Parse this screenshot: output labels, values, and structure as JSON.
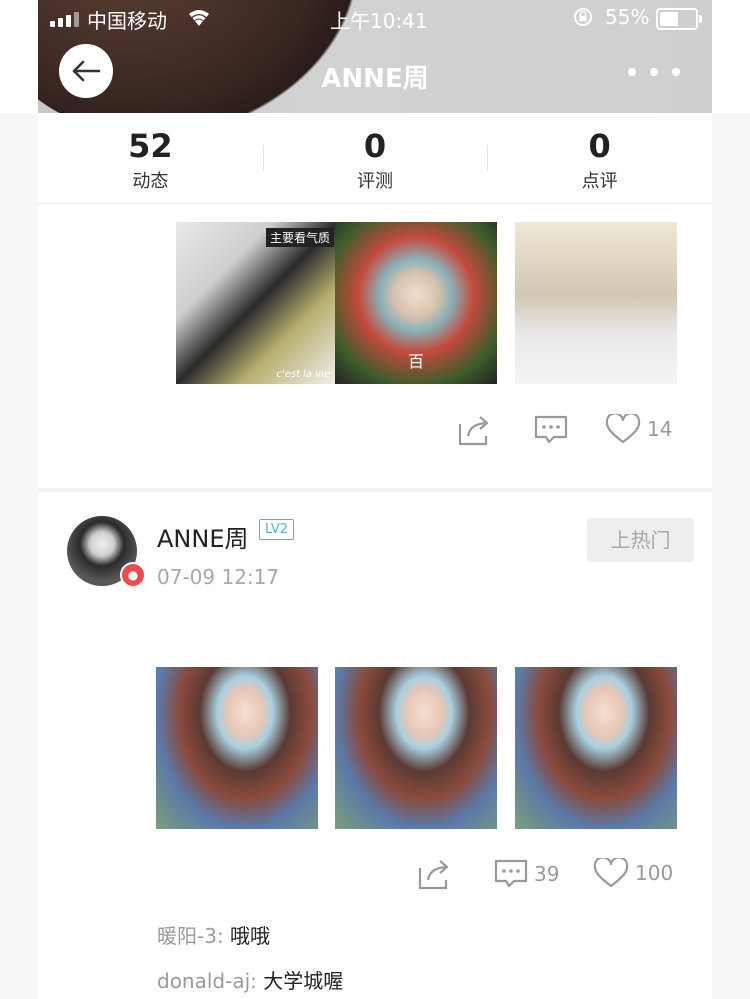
{
  "status_bar": {
    "carrier": "中国移动",
    "time": "上午10:41",
    "battery": "55%"
  },
  "header": {
    "title": "ANNE周"
  },
  "stats": [
    {
      "value": "52",
      "label": "动态"
    },
    {
      "value": "0",
      "label": "评测"
    },
    {
      "value": "0",
      "label": "点评"
    }
  ],
  "post1": {
    "photos": [
      {
        "stamp": "主要看气质",
        "sign": "c'est la vie"
      },
      {
        "caption": "百"
      },
      {}
    ],
    "like_count": "14"
  },
  "post2": {
    "author": "ANNE周",
    "level": "LV2",
    "time": "07-09 12:17",
    "hot_button": "上热门",
    "comment_count": "39",
    "like_count": "100",
    "comments": [
      {
        "user": "暖阳-3:",
        "text": "哦哦"
      },
      {
        "user": "donald-aj:",
        "text": "大学城喔"
      }
    ]
  },
  "colors": {
    "accent": "#54b0d8",
    "badge": "#ef4b4b",
    "icon_gray": "#9a9a9a"
  }
}
